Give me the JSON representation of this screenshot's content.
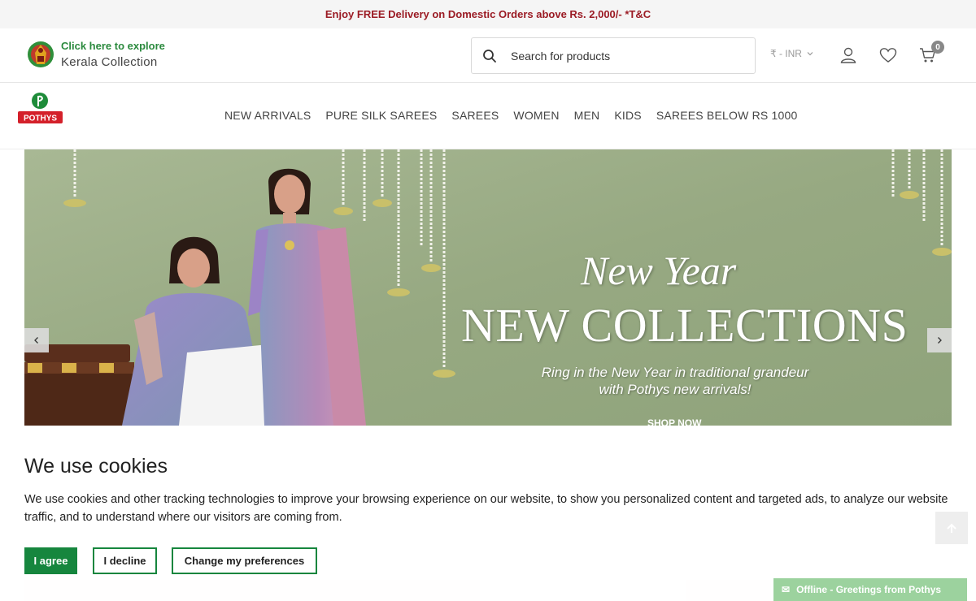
{
  "topbar": {
    "text": "Enjoy FREE Delivery on Domestic Orders above Rs. 2,000/- *T&C"
  },
  "header": {
    "kerala_line1": "Click here to explore",
    "kerala_line2": "Kerala Collection",
    "search_placeholder": "Search for products",
    "currency": "₹ - INR",
    "cart_count": "0",
    "icons": [
      "search-icon",
      "chevron-down-icon",
      "user-icon",
      "heart-icon",
      "cart-icon"
    ]
  },
  "brand": {
    "logo_text": "POTHYS"
  },
  "nav": {
    "items": [
      "NEW ARRIVALS",
      "PURE SILK SAREES",
      "SAREES",
      "WOMEN",
      "MEN",
      "KIDS",
      "SAREES BELOW RS 1000"
    ]
  },
  "hero": {
    "line1": "New Year",
    "line2": "NEW COLLECTIONS",
    "line3": "Ring in the New Year in traditional grandeur",
    "line4": "with Pothys new arrivals!",
    "cta": "SHOP NOW"
  },
  "chat": {
    "text": "Offline - Greetings from Pothys"
  },
  "cookie": {
    "title": "We use cookies",
    "text": "We use cookies and other tracking technologies to improve your browsing experience on our website, to show you personalized content and targeted ads, to analyze our website traffic, and to understand where our visitors are coming from.",
    "agree": "I agree",
    "decline": "I decline",
    "preferences": "Change my preferences"
  },
  "colors": {
    "promo_text": "#9b1b24",
    "brand_red": "#d4202a",
    "brand_green": "#16863e",
    "hero_bg": "#9aab86"
  }
}
